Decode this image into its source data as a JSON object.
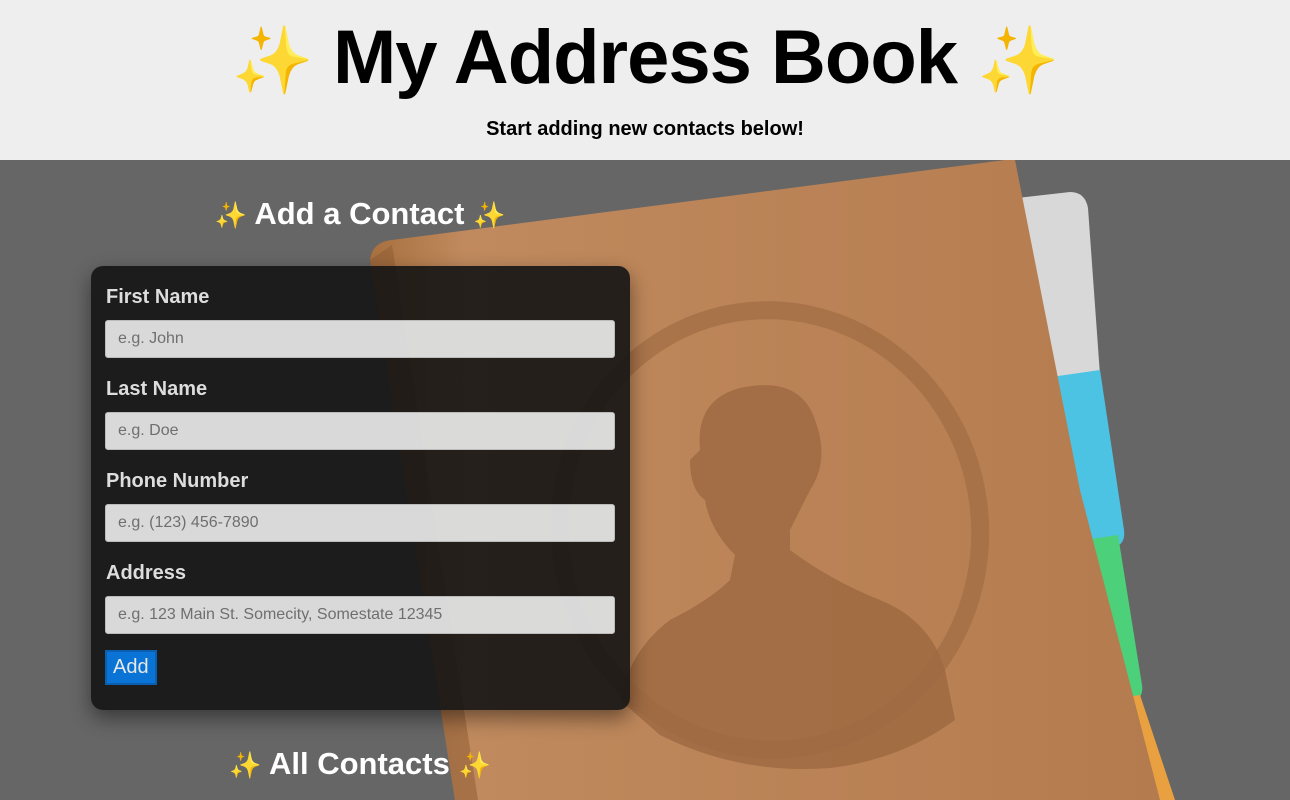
{
  "header": {
    "title": "My Address Book",
    "subtitle": "Start adding new contacts below!",
    "sparkle": "✨"
  },
  "add_section": {
    "title": "Add a Contact",
    "sparkle": "✨"
  },
  "form": {
    "fields": [
      {
        "label": "First Name",
        "placeholder": "e.g. John"
      },
      {
        "label": "Last Name",
        "placeholder": "e.g. Doe"
      },
      {
        "label": "Phone Number",
        "placeholder": "e.g. (123) 456-7890"
      },
      {
        "label": "Address",
        "placeholder": "e.g. 123 Main St. Somecity, Somestate 12345"
      }
    ],
    "submit_label": "Add"
  },
  "contacts_section": {
    "title": "All Contacts",
    "sparkle": "✨"
  },
  "colors": {
    "header_bg": "#eeeeee",
    "page_bg": "#666666",
    "button_bg": "#0a74d6",
    "book_cover": "#b97f52",
    "tab_gray": "#d8d8d8",
    "tab_blue": "#4cc3e3",
    "tab_green": "#4cd07a",
    "tab_orange": "#e8a040"
  }
}
